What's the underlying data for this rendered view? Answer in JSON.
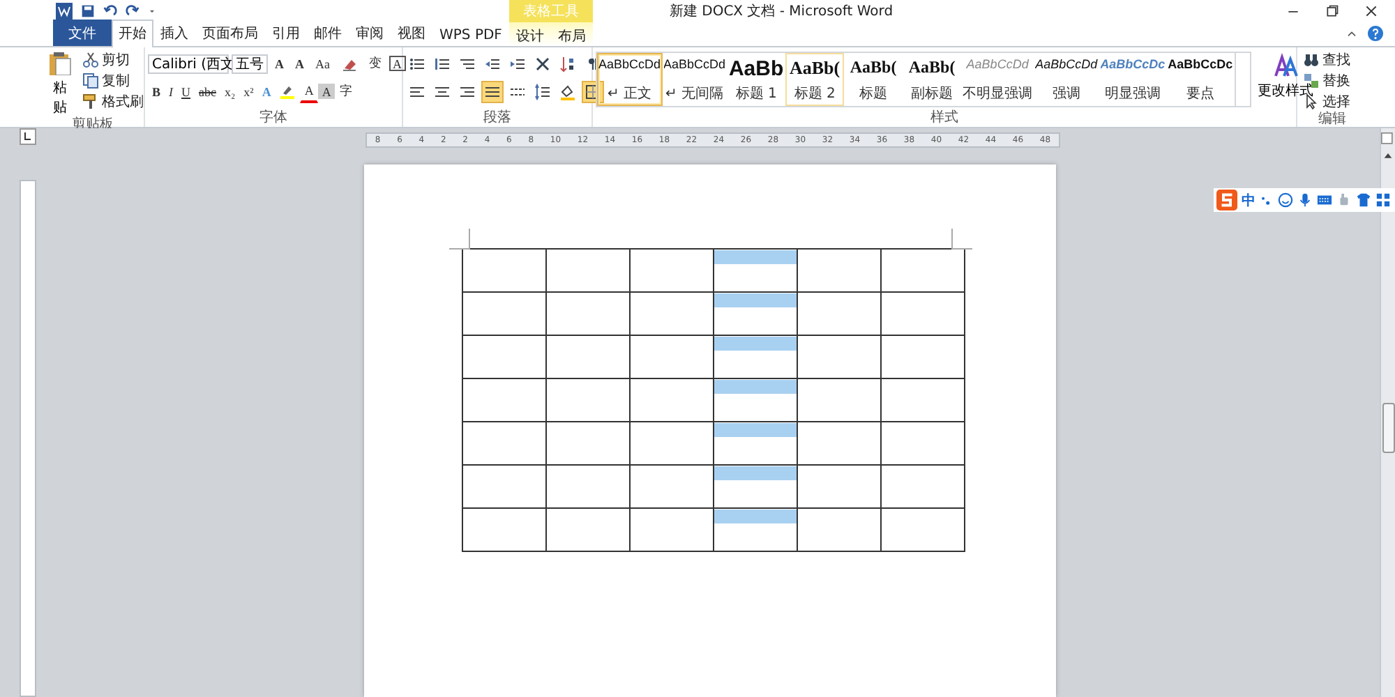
{
  "window": {
    "title": "新建 DOCX 文档 - Microsoft Word"
  },
  "contextual_group": {
    "label": "表格工具"
  },
  "tabs": [
    {
      "label": "文件",
      "kind": "file",
      "selected": false
    },
    {
      "label": "开始",
      "kind": "tab",
      "selected": true
    },
    {
      "label": "插入",
      "kind": "tab",
      "selected": false
    },
    {
      "label": "页面布局",
      "kind": "tab",
      "selected": false
    },
    {
      "label": "引用",
      "kind": "tab",
      "selected": false
    },
    {
      "label": "邮件",
      "kind": "tab",
      "selected": false
    },
    {
      "label": "审阅",
      "kind": "tab",
      "selected": false
    },
    {
      "label": "视图",
      "kind": "tab",
      "selected": false
    },
    {
      "label": "WPS PDF",
      "kind": "tab",
      "selected": false
    },
    {
      "label": "设计",
      "kind": "context",
      "selected": false
    },
    {
      "label": "布局",
      "kind": "context",
      "selected": false
    }
  ],
  "clipboard": {
    "paste": "粘贴",
    "items": [
      {
        "kind": "cut",
        "label": "剪切"
      },
      {
        "kind": "copy",
        "label": "复制"
      },
      {
        "kind": "painter",
        "label": "格式刷"
      }
    ],
    "label": "剪贴板"
  },
  "font": {
    "name": "Calibri (西文",
    "size": "五号",
    "label": "字体",
    "row1": [
      {
        "kind": "grow",
        "label": "A"
      },
      {
        "kind": "shrink",
        "label": "A"
      },
      {
        "kind": "case",
        "label": "Aa"
      },
      {
        "kind": "clear"
      },
      {
        "kind": "phonetic",
        "label": "变"
      },
      {
        "kind": "border",
        "label": "A"
      }
    ],
    "row2": [
      {
        "kind": "bold",
        "label": "B"
      },
      {
        "kind": "italic",
        "label": "I"
      },
      {
        "kind": "underline",
        "label": "U"
      },
      {
        "kind": "strike",
        "label": "abc"
      },
      {
        "kind": "sub",
        "label": "x₂"
      },
      {
        "kind": "sup",
        "label": "x²"
      },
      {
        "kind": "effects",
        "label": "A"
      },
      {
        "kind": "highlight"
      },
      {
        "kind": "color",
        "label": "A"
      },
      {
        "kind": "shading",
        "label": "A"
      },
      {
        "kind": "enclose",
        "label": "字"
      }
    ]
  },
  "paragraph": {
    "label": "段落",
    "row1": [
      {
        "kind": "bullets",
        "selected": false
      },
      {
        "kind": "numbering",
        "selected": false
      },
      {
        "kind": "multilevel",
        "selected": false
      },
      {
        "kind": "outdent",
        "selected": false
      },
      {
        "kind": "indent",
        "selected": false
      },
      {
        "kind": "asian",
        "selected": false
      },
      {
        "kind": "sort",
        "selected": false
      },
      {
        "kind": "marks",
        "selected": false
      }
    ],
    "row2": [
      {
        "kind": "left",
        "selected": false
      },
      {
        "kind": "center",
        "selected": false
      },
      {
        "kind": "right",
        "selected": false
      },
      {
        "kind": "justify",
        "selected": true
      },
      {
        "kind": "distribute",
        "selected": false
      },
      {
        "kind": "spacing",
        "selected": false
      },
      {
        "kind": "fill",
        "selected": false
      },
      {
        "kind": "borders",
        "selected": true
      }
    ]
  },
  "styles": {
    "label": "样式",
    "change": "更改样式",
    "items": [
      {
        "sample": "AaBbCcDd",
        "name": "↵ 正文",
        "kind": "normal",
        "selected": true,
        "hovered": false
      },
      {
        "sample": "AaBbCcDd",
        "name": "↵ 无间隔",
        "kind": "normal",
        "selected": false,
        "hovered": false
      },
      {
        "sample": "AaBb",
        "name": "标题 1",
        "kind": "heading1",
        "selected": false,
        "hovered": false
      },
      {
        "sample": "AaBb(",
        "name": "标题 2",
        "kind": "heading2",
        "selected": false,
        "hovered": true
      },
      {
        "sample": "AaBb(",
        "name": "标题",
        "kind": "title",
        "selected": false,
        "hovered": false
      },
      {
        "sample": "AaBb(",
        "name": "副标题",
        "kind": "title",
        "selected": false,
        "hovered": false
      },
      {
        "sample": "AaBbCcDd",
        "name": "不明显强调",
        "kind": "subtle",
        "selected": false,
        "hovered": false
      },
      {
        "sample": "AaBbCcDd",
        "name": "强调",
        "kind": "emphasis",
        "selected": false,
        "hovered": false
      },
      {
        "sample": "AaBbCcDc",
        "name": "明显强调",
        "kind": "intense",
        "selected": false,
        "hovered": false
      },
      {
        "sample": "AaBbCcDc",
        "name": "要点",
        "kind": "strong",
        "selected": false,
        "hovered": false
      }
    ]
  },
  "editing": {
    "label": "编辑",
    "items": [
      {
        "kind": "find",
        "label": "查找"
      },
      {
        "kind": "replace",
        "label": "替换"
      },
      {
        "kind": "select",
        "label": "选择"
      }
    ]
  },
  "ruler": {
    "labels": [
      "8",
      "6",
      "4",
      "2",
      "2",
      "4",
      "6",
      "8",
      "10",
      "12",
      "14",
      "16",
      "18",
      "22",
      "24",
      "26",
      "28",
      "30",
      "32",
      "34",
      "36",
      "38",
      "40",
      "42",
      "44",
      "46",
      "48"
    ]
  },
  "ime": {
    "label": "中"
  },
  "table": {
    "rows": [
      {
        "cells": [
          {
            "shaded": false
          },
          {
            "shaded": false
          },
          {
            "shaded": false
          },
          {
            "shaded": true
          },
          {
            "shaded": false
          },
          {
            "shaded": false
          }
        ]
      },
      {
        "cells": [
          {
            "shaded": false
          },
          {
            "shaded": false
          },
          {
            "shaded": false
          },
          {
            "shaded": true
          },
          {
            "shaded": false
          },
          {
            "shaded": false
          }
        ]
      },
      {
        "cells": [
          {
            "shaded": false
          },
          {
            "shaded": false
          },
          {
            "shaded": false
          },
          {
            "shaded": true
          },
          {
            "shaded": false
          },
          {
            "shaded": false
          }
        ]
      },
      {
        "cells": [
          {
            "shaded": false
          },
          {
            "shaded": false
          },
          {
            "shaded": false
          },
          {
            "shaded": true
          },
          {
            "shaded": false
          },
          {
            "shaded": false
          }
        ]
      },
      {
        "cells": [
          {
            "shaded": false
          },
          {
            "shaded": false
          },
          {
            "shaded": false
          },
          {
            "shaded": true
          },
          {
            "shaded": false
          },
          {
            "shaded": false
          }
        ]
      },
      {
        "cells": [
          {
            "shaded": false
          },
          {
            "shaded": false
          },
          {
            "shaded": false
          },
          {
            "shaded": true
          },
          {
            "shaded": false
          },
          {
            "shaded": false
          }
        ]
      },
      {
        "cells": [
          {
            "shaded": false
          },
          {
            "shaded": false
          },
          {
            "shaded": false
          },
          {
            "shaded": true
          },
          {
            "shaded": false
          },
          {
            "shaded": false
          }
        ]
      }
    ]
  }
}
